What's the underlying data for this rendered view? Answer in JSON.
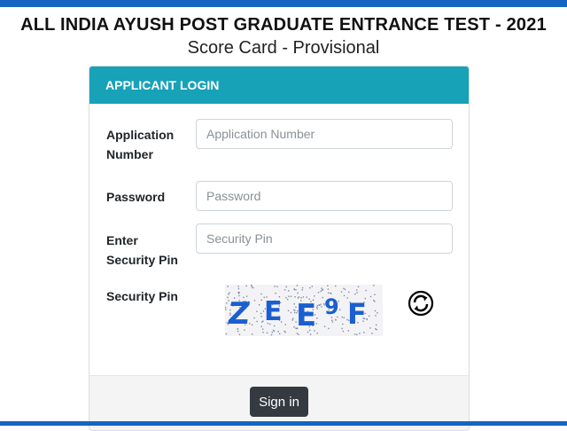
{
  "header": {
    "title": "ALL INDIA AYUSH POST GRADUATE ENTRANCE TEST - 2021",
    "subtitle": "Score Card - Provisional"
  },
  "login": {
    "heading": "APPLICANT LOGIN",
    "application_number": {
      "label_line1": "Application",
      "label_line2": "Number",
      "placeholder": "Application Number",
      "value": ""
    },
    "password": {
      "label": "Password",
      "placeholder": "Password",
      "value": ""
    },
    "security_pin_input": {
      "label_line1": "Enter",
      "label_line2": "Security Pin",
      "placeholder": "Security Pin",
      "value": ""
    },
    "captcha": {
      "label": "Security Pin",
      "characters": [
        "Z",
        "E",
        "E",
        "9",
        "F"
      ],
      "refresh_icon": "refresh-icon"
    },
    "submit_label": "Sign in"
  },
  "colors": {
    "top_bar": "#1565c0",
    "card_header": "#17a2b8",
    "captcha_text": "#1a5fd1",
    "button": "#343a40"
  }
}
